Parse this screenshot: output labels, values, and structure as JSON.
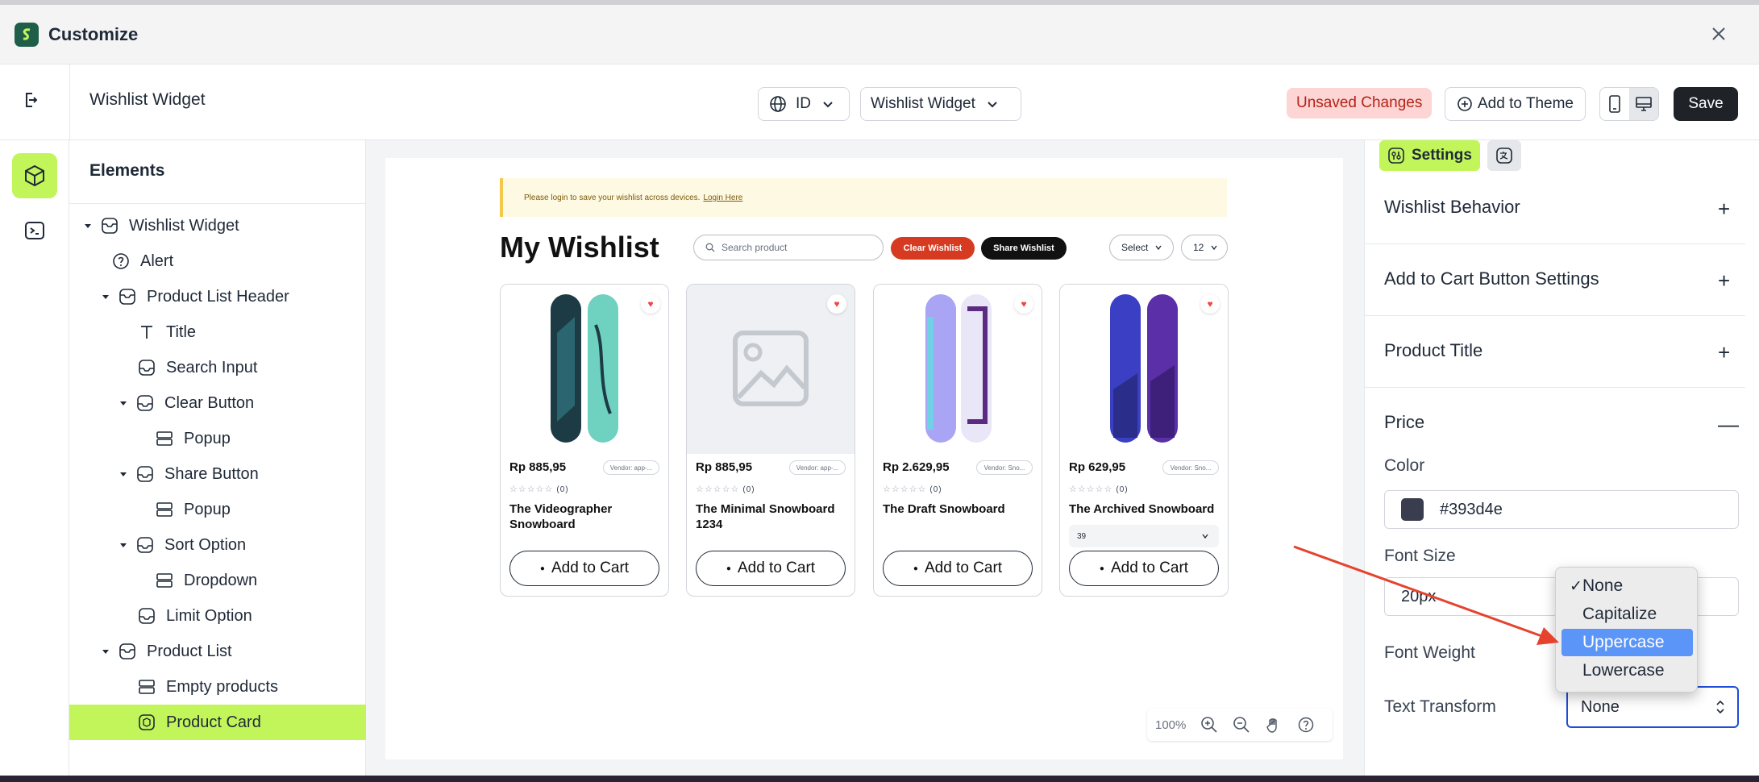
{
  "window": {
    "title": "Customize"
  },
  "toolbar": {
    "page_title": "Wishlist Widget",
    "language": "ID",
    "template": "Wishlist Widget",
    "unsaved": "Unsaved Changes",
    "add_to_theme": "Add to Theme",
    "save": "Save"
  },
  "elements": {
    "title": "Elements",
    "tree": [
      {
        "label": "Wishlist Widget"
      },
      {
        "label": "Alert"
      },
      {
        "label": "Product List Header"
      },
      {
        "label": "Title"
      },
      {
        "label": "Search Input"
      },
      {
        "label": "Clear Button"
      },
      {
        "label": "Popup"
      },
      {
        "label": "Share Button"
      },
      {
        "label": "Popup"
      },
      {
        "label": "Sort Option"
      },
      {
        "label": "Dropdown"
      },
      {
        "label": "Limit Option"
      },
      {
        "label": "Product List"
      },
      {
        "label": "Empty products"
      },
      {
        "label": "Product Card"
      }
    ]
  },
  "preview": {
    "alert_text": "Please login to save your wishlist across devices.",
    "alert_link": "Login Here",
    "title": "My Wishlist",
    "search_placeholder": "Search product",
    "clear_btn": "Clear Wishlist",
    "share_btn": "Share Wishlist",
    "sort_select": "Select",
    "limit_select": "12",
    "products": [
      {
        "price": "Rp 885,95",
        "vendor": "Vendor: app-...",
        "reviews": "(0)",
        "title": "The Videographer Snowboard",
        "add": "Add to Cart"
      },
      {
        "price": "Rp 885,95",
        "vendor": "Vendor: app-...",
        "reviews": "(0)",
        "title": "The Minimal Snowboard 1234",
        "add": "Add to Cart"
      },
      {
        "price": "Rp 2.629,95",
        "vendor": "Vendor: Sno...",
        "reviews": "(0)",
        "title": "The Draft Snowboard",
        "add": "Add to Cart"
      },
      {
        "price": "Rp 629,95",
        "vendor": "Vendor: Sno...",
        "reviews": "(0)",
        "title": "The Archived Snowboard",
        "variant": "39",
        "add": "Add to Cart"
      }
    ],
    "zoom": "100%"
  },
  "settings": {
    "tab_settings": "Settings",
    "sections": [
      "Wishlist Behavior",
      "Add to Cart Button Settings",
      "Product Title",
      "Price"
    ],
    "color_label": "Color",
    "color_value": "#393d4e",
    "font_size_label": "Font Size",
    "font_size_value": "20px",
    "font_weight_label": "Font Weight",
    "text_transform_label": "Text Transform",
    "text_transform_value": "None"
  },
  "dropdown": {
    "options": [
      "None",
      "Capitalize",
      "Uppercase",
      "Lowercase"
    ],
    "checked": "None",
    "highlighted": "Uppercase"
  },
  "colors": {
    "accent": "#c2f55a",
    "save_bg": "#1f2328",
    "clear_btn": "#d63b22",
    "share_btn": "#111111",
    "arrow": "#e5432e"
  }
}
